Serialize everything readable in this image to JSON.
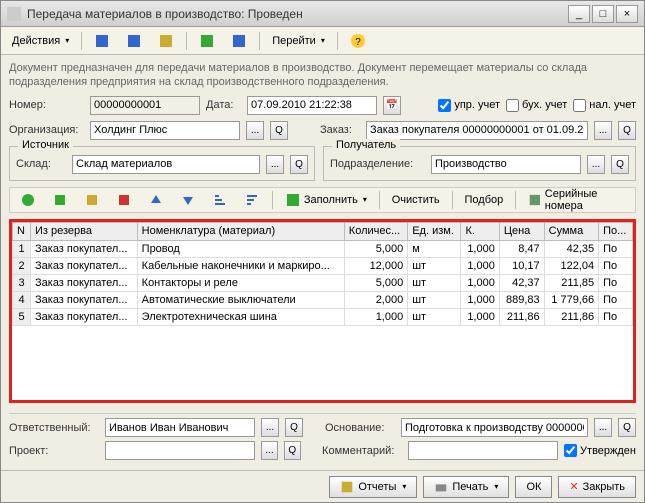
{
  "window": {
    "title": "Передача материалов в производство: Проведен"
  },
  "toolbar": {
    "actions": "Действия",
    "goto": "Перейти"
  },
  "desc": "Документ предназначен для передачи материалов в производство. Документ перемещает материалы со склада подразделения предприятия на склад производственного подразделения.",
  "fields": {
    "number_label": "Номер:",
    "number": "00000000001",
    "date_label": "Дата:",
    "date": "07.09.2010 21:22:38",
    "upr": "упр. учет",
    "buh": "бух. учет",
    "nal": "нал. учет",
    "org_label": "Организация:",
    "org": "Холдинг Плюс",
    "order_label": "Заказ:",
    "order": "Заказ покупателя 00000000001 от 01.09.20"
  },
  "source": {
    "title": "Источник",
    "sklad_label": "Склад:",
    "sklad": "Склад материалов"
  },
  "dest": {
    "title": "Получатель",
    "podr_label": "Подразделение:",
    "podr": "Производство"
  },
  "tb2": {
    "fill": "Заполнить",
    "clear": "Очистить",
    "select": "Подбор",
    "serial": "Серийные номера"
  },
  "table": {
    "headers": [
      "N",
      "Из резерва",
      "Номенклатура (материал)",
      "Количес...",
      "Ед. изм.",
      "К.",
      "Цена",
      "Сумма",
      "По..."
    ],
    "rows": [
      {
        "n": "1",
        "rez": "Заказ покупател...",
        "nom": "Провод",
        "qty": "5,000",
        "ed": "м",
        "k": "1,000",
        "price": "8,47",
        "sum": "42,35",
        "po": "По"
      },
      {
        "n": "2",
        "rez": "Заказ покупател...",
        "nom": "Кабельные наконечники и маркиро...",
        "qty": "12,000",
        "ed": "шт",
        "k": "1,000",
        "price": "10,17",
        "sum": "122,04",
        "po": "По"
      },
      {
        "n": "3",
        "rez": "Заказ покупател...",
        "nom": "Контакторы и реле",
        "qty": "5,000",
        "ed": "шт",
        "k": "1,000",
        "price": "42,37",
        "sum": "211,85",
        "po": "По"
      },
      {
        "n": "4",
        "rez": "Заказ покупател...",
        "nom": "Автоматические выключатели",
        "qty": "2,000",
        "ed": "шт",
        "k": "1,000",
        "price": "889,83",
        "sum": "1 779,66",
        "po": "По"
      },
      {
        "n": "5",
        "rez": "Заказ покупател...",
        "nom": "Электротехническая шина",
        "qty": "1,000",
        "ed": "шт",
        "k": "1,000",
        "price": "211,86",
        "sum": "211,86",
        "po": "По"
      }
    ]
  },
  "footer": {
    "resp_label": "Ответственный:",
    "resp": "Иванов Иван Иванович",
    "basis_label": "Основание:",
    "basis": "Подготовка к производству 000000000",
    "proj_label": "Проект:",
    "proj": "",
    "comment_label": "Комментарий:",
    "comment": "",
    "approved": "Утвержден"
  },
  "buttons": {
    "reports": "Отчеты",
    "print": "Печать",
    "ok": "ОК",
    "close": "Закрыть"
  }
}
